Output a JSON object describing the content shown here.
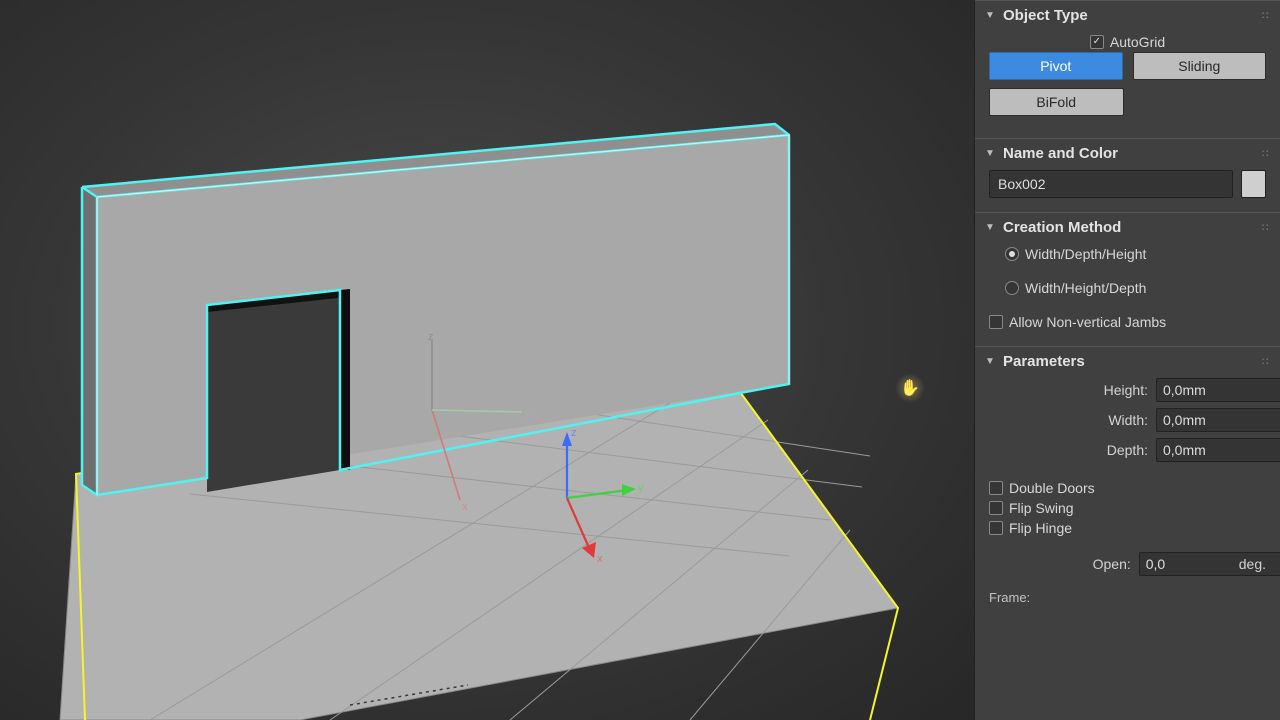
{
  "accent": "#3d8be0",
  "sections": {
    "objectType": {
      "title": "Object Type",
      "autoGrid": {
        "label": "AutoGrid",
        "checked": true
      },
      "buttons": {
        "pivot": "Pivot",
        "sliding": "Sliding",
        "bifold": "BiFold"
      },
      "active": "pivot"
    },
    "nameAndColor": {
      "title": "Name and Color",
      "name": "Box002"
    },
    "creationMethod": {
      "title": "Creation Method",
      "options": {
        "wdh": "Width/Depth/Height",
        "whd": "Width/Height/Depth"
      },
      "selected": "wdh",
      "allowNonVertical": {
        "label": "Allow Non-vertical Jambs",
        "checked": false
      }
    },
    "parameters": {
      "title": "Parameters",
      "height": {
        "label": "Height:",
        "value": "0,0mm"
      },
      "width": {
        "label": "Width:",
        "value": "0,0mm"
      },
      "depth": {
        "label": "Depth:",
        "value": "0,0mm"
      },
      "doubleDoors": {
        "label": "Double Doors",
        "checked": false
      },
      "flipSwing": {
        "label": "Flip Swing",
        "checked": false
      },
      "flipHinge": {
        "label": "Flip Hinge",
        "checked": false
      },
      "open": {
        "label": "Open:",
        "value": "0,0",
        "unit": "deg."
      },
      "frameLabel": "Frame:"
    }
  },
  "viewport": {
    "axis_labels": {
      "x": "x",
      "y": "y",
      "z": "z"
    }
  }
}
